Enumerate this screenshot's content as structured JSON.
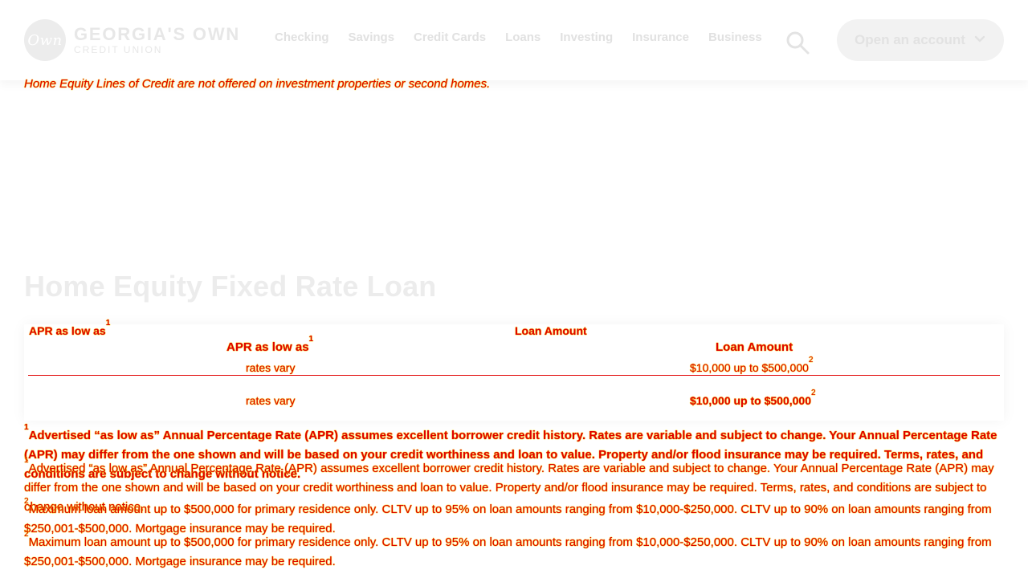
{
  "header": {
    "brand": {
      "badge": "Own",
      "title": "GEORGIA'S OWN",
      "subtitle": "CREDIT UNION"
    },
    "nav": [
      "Checking",
      "Savings",
      "Credit Cards",
      "Loans",
      "Investing",
      "Insurance",
      "Business"
    ],
    "open_account": "Open an account"
  },
  "content": {
    "note_red": "Home Equity Lines of Credit are not offered on investment properties or second homes.",
    "note_soft": "",
    "section_title": "Home Equity Fixed Rate Loan",
    "table": {
      "ghost_headers": [
        "APR as low as",
        "Loan Amount"
      ],
      "headers": [
        "APR as low as",
        "Loan Amount"
      ],
      "header_sup": [
        "1",
        ""
      ],
      "ghost_row": {
        "apr": "rates vary",
        "amount": "$10,000 up to $500,000",
        "amount_sup": "2"
      },
      "row": {
        "apr": "rates vary",
        "amount": "$10,000 up to $500,000",
        "amount_sup": "2"
      }
    },
    "footnotes": {
      "note1_sup": "1",
      "note1": "Advertised “as low as” Annual Percentage Rate (APR) assumes excellent borrower credit history. Rates are variable and subject to change. Your Annual Percentage Rate (APR) may differ from the one shown and will be based on your credit worthiness and loan to value. Property and/or flood insurance may be required. Terms, rates, and conditions are subject to change without notice.",
      "note2_sup": "2",
      "note2": "Maximum loan amount up to $500,000 for primary residence only. CLTV up to 95% on loan amounts ranging from $10,000-$250,000. CLTV up to 90% on loan amounts ranging from $250,001-$500,000. Mortgage insurance may be required."
    }
  },
  "colors": {
    "accent_red": "#e00000",
    "outline_yellow": "#f2d100",
    "ghost_gray": "#e7e7e7"
  }
}
